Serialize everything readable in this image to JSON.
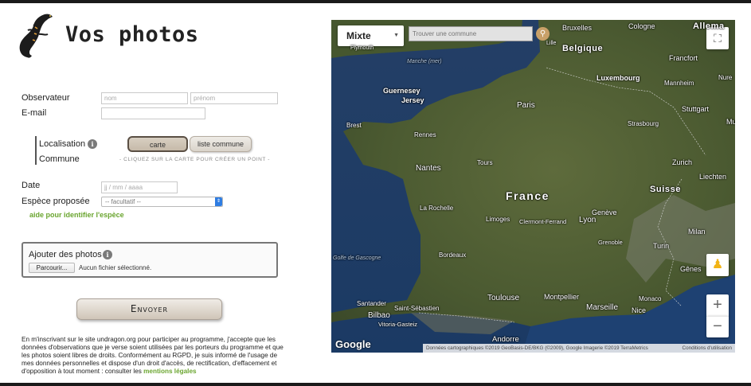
{
  "header": {
    "title": "Vos photos"
  },
  "form": {
    "observer_label": "Observateur",
    "lastname_placeholder": "nom",
    "firstname_placeholder": "prénom",
    "email_label": "E-mail",
    "localisation_label": "Localisation",
    "commune_label": "Commune",
    "toggle_map": "carte",
    "toggle_commune": "liste commune",
    "map_hint": "- Cliquez sur la carte pour créer un point -",
    "date_label": "Date",
    "date_placeholder": "jj / mm / aaaa",
    "species_label": "Espèce proposée",
    "species_selected": "-- facultatif --",
    "species_help": "aide pour identifier l'espèce",
    "photos_label": "Ajouter des photos",
    "browse_label": "Parcourir...",
    "file_status": "Aucun fichier sélectionné.",
    "submit_label": "Envoyer",
    "legal_text": "En m'inscrivant sur le site undragon.org pour participer au programme, j'accepte que les données d'observations que je verse soient utilisées par les porteurs du programme et que les photos soient libres de droits. Conformément au RGPD, je suis informé de l'usage de mes données personnelles et dispose d'un droit d'accès, de rectification, d'effacement et d'opposition à tout moment : consulter les ",
    "legal_link": "mentions légales"
  },
  "map": {
    "type_selected": "Mixte",
    "search_placeholder": "Trouver une commune",
    "google_label": "Google",
    "attribution": "Données cartographiques ©2019 GeoBasis-DE/BKG (©2009), Google Imagerie ©2019 TerraMetrics",
    "terms": "Conditions d'utilisation",
    "labels": {
      "bruxelles": "Bruxelles",
      "cologne": "Cologne",
      "allemagne": "Allema",
      "plymouth": "Plymouth",
      "belgique": "Belgique",
      "lille": "Lille",
      "manche": "Manche (mer)",
      "francfort": "Francfort",
      "luxembourg": "Luxembourg",
      "mannheim": "Mannheim",
      "nuremberg": "Nure",
      "guernesey": "Guernesey",
      "jersey": "Jersey",
      "paris": "Paris",
      "stuttgart": "Stuttgart",
      "brest": "Brest",
      "rennes": "Rennes",
      "strasbourg": "Strasbourg",
      "munich": "Mu",
      "nantes": "Nantes",
      "tours": "Tours",
      "zurich": "Zurich",
      "liechtenstein": "Liechten",
      "france": "France",
      "suisse": "Suisse",
      "la_rochelle": "La Rochelle",
      "limoges": "Limoges",
      "clermont": "Clermont-Ferrand",
      "lyon": "Lyon",
      "geneve": "Genève",
      "grenoble": "Grenoble",
      "milan": "Milan",
      "bordeaux": "Bordeaux",
      "golfe": "Golfe de Gascogne",
      "turin": "Turin",
      "genes": "Gênes",
      "toulouse": "Toulouse",
      "montpellier": "Montpellier",
      "monaco": "Monaco",
      "santander": "Santander",
      "saint_sebastien": "Saint-Sébastien",
      "marseille": "Marseille",
      "nice": "Nice",
      "bilbao": "Bilbao",
      "vitoria": "Vitoria-Gasteiz",
      "andorre": "Andorre"
    }
  }
}
